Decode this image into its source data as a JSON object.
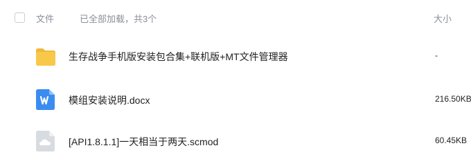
{
  "header": {
    "name_label": "文件",
    "status": "已全部加载，共3个",
    "size_label": "大小"
  },
  "files": [
    {
      "name": "生存战争手机版安装包合集+联机版+MT文件管理器",
      "size": "-",
      "icon": "folder-icon",
      "color": "#f5c342"
    },
    {
      "name": "模组安装说明.docx",
      "size": "216.50KB",
      "icon": "word-doc-icon",
      "color": "#3b8cf0"
    },
    {
      "name": "[API1.8.1.1]一天相当于两天.scmod",
      "size": "60.45KB",
      "icon": "cloud-file-icon",
      "color": "#d8dbe0"
    }
  ]
}
